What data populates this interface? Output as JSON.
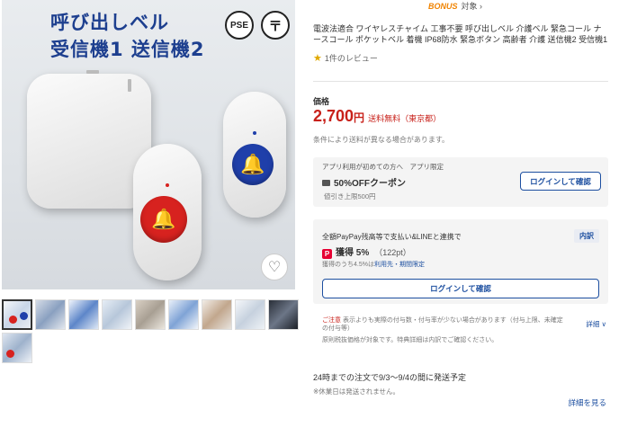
{
  "gallery": {
    "image_title_line1": "呼び出しベル",
    "image_title_line2": "受信機1 送信機2",
    "cert_pse": "PSE",
    "cert_tel": "〒",
    "favorite_icon": "heart-icon",
    "bell_icon": "bell-icon",
    "thumbnail_count": 10
  },
  "bonus": {
    "label": "BONUS",
    "text": "対象 ›"
  },
  "product": {
    "title": "電波法適合 ワイヤレスチャイム 工事不要 呼び出しベル 介護ベル 緊急コール ナースコール ポケットベル 着機 IP68防水 緊急ボタン 高齢者 介護 送信機2 受信機1",
    "review_text": "1件のレビュー",
    "price_label": "価格",
    "price": "2,700",
    "yen": "円",
    "shipping": "送料無料（東京都）",
    "shipping_note": "条件により送料が異なる場合があります。"
  },
  "coupon": {
    "tags": "アプリ利用が初めての方へ　アプリ限定",
    "title": "50%OFFクーポン",
    "sub": "値引き上限500円",
    "login_label": "ログインして確認"
  },
  "paypay": {
    "head": "全額PayPay残高等で支払い&LINEと連携で",
    "badge": "内訳",
    "earn_label": "獲得 5%",
    "points": "（122pt）",
    "note": "獲得のうち4.5%は",
    "note_link": "利用先・期間限定",
    "login_label": "ログインして確認"
  },
  "caution": {
    "title": "ご注意",
    "text": "表示よりも実際の付与数・付与率が少ない場合があります（付与上限、未確定の付与等）",
    "link": "詳細 ∨",
    "tax_note": "原則税抜価格が対象です。特典詳細は内訳でご確認ください。"
  },
  "delivery": {
    "ship_date": "24時までの注文で9/3〜9/4の間に発送予定",
    "holiday_note": "※休業日は発送されません。",
    "detail_link": "詳細を見る"
  },
  "colors": {
    "price_red": "#c8211a",
    "link_blue": "#1d4fa0",
    "bonus_orange": "#f08300",
    "button_red": "#d7221f",
    "button_blue": "#1f3faa"
  }
}
